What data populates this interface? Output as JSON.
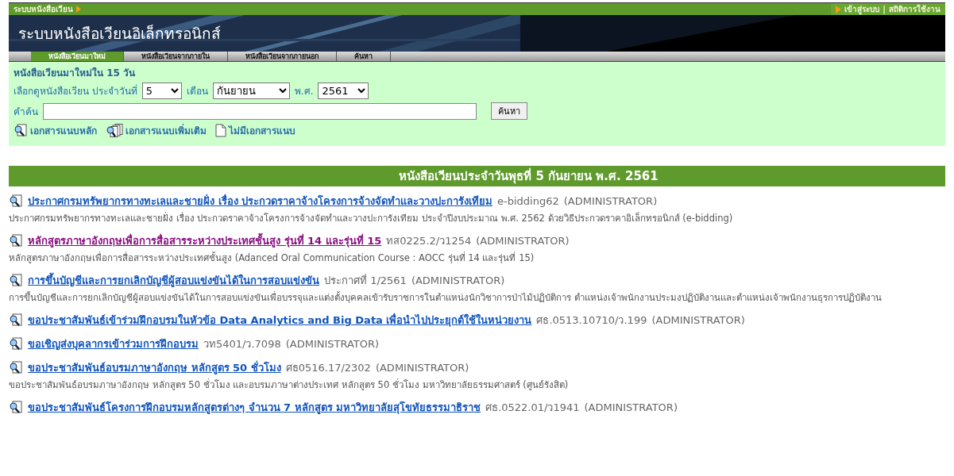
{
  "top_bar": {
    "title": "ระบบหนังสือเวียน",
    "links": [
      "เข้าสู่ระบบ",
      "สถิติการใช้งาน"
    ],
    "separator": "|"
  },
  "banner": {
    "title": "ระบบหนังสือเวียนอิเล็กทรอนิกส์"
  },
  "tabs": [
    {
      "label": "หนังสือเวียนมาใหม่",
      "selected": true
    },
    {
      "label": "หนังสือเวียนจากภายใน",
      "selected": false
    },
    {
      "label": "หนังสือเวียนจากภายนอก",
      "selected": false
    },
    {
      "label": "ค้นหา",
      "selected": false
    }
  ],
  "filter": {
    "heading": "หนังสือเวียนมาใหม่ใน 15 วัน",
    "date_label": "เลือกดูหนังสือเวียน ประจำวันที่",
    "day": "5",
    "month_label": "เดือน",
    "month": "กันยายน",
    "year_label": "พ.ศ.",
    "year": "2561",
    "keyword_label": "คำค้น",
    "search_button": "ค้นหา"
  },
  "legend": [
    {
      "kind": "main",
      "label": "เอกสารแนบหลัก"
    },
    {
      "kind": "extra",
      "label": "เอกสารแนบเพิ่มเติม"
    },
    {
      "kind": "none",
      "label": "ไม่มีเอกสารแนบ"
    }
  ],
  "list_heading": "หนังสือเวียนประจำวันพุธที่ 5 กันยายน พ.ศ. 2561",
  "items": [
    {
      "kind": "main",
      "title": "ประกาศกรมทรัพยากรทางทะเลและชายฝั่ง เรื่อง ประกวดราคาจ้างโครงการจ้างจัดทำและวางปะการังเทียม",
      "visited": false,
      "ref": "e-bidding62",
      "author": "(ADMINISTRATOR)",
      "description": "ประกาศกรมทรัพยากรทางทะเลและชายฝั่ง เรื่อง ประกวดราคาจ้างโครงการจ้างจัดทำและวางปะการังเทียม ประจำปีงบประมาณ พ.ศ. 2562 ด้วยวิธีประกวดราคาอิเล็กทรอนิกส์ (e-bidding)"
    },
    {
      "kind": "main",
      "title": "หลักสูตรภาษาอังกฤษเพื่อการสื่อสารระหว่างประเทศชั้นสูง รุ่นที่ 14 และรุ่นที่ 15",
      "visited": true,
      "ref": "ทส0225.2/ว1254",
      "author": "(ADMINISTRATOR)",
      "description": "หลักสูตรภาษาอังกฤษเพื่อการสื่อสารระหว่างประเทศชั้นสูง (Adanced Oral Communication Course : AOCC รุ่นที่ 14 และรุ่นที่ 15)"
    },
    {
      "kind": "main",
      "title": "การขึ้นบัญชีและการยกเลิกบัญชีผู้สอบแข่งขันได้ในการสอบแข่งขัน",
      "visited": false,
      "ref": "ประกาศที่ 1/2561",
      "author": "(ADMINISTRATOR)",
      "description": "การขึ้นบัญชีและการยกเลิกบัญชีผู้สอบแข่งขันได้ในการสอบแข่งขันเพื่อบรรจุและแต่งตั้งบุคคลเข้ารับราชการในตำแหน่งนักวิชาการป่าไม้ปฏิบัติการ ตำแหน่งเจ้าพนักงานประมงปฏิบัติงานและตำแหน่งเจ้าพนักงานธุรการปฏิบัติงาน"
    },
    {
      "kind": "main",
      "title": "ขอประชาสัมพันธ์เข้าร่วมฝึกอบรมในหัวข้อ Data Analytics and Big Data เพื่อนำไปประยุกต์ใช้ในหน่วยงาน",
      "visited": false,
      "ref": "ศธ.0513.10710/ว.199",
      "author": "(ADMINISTRATOR)"
    },
    {
      "kind": "main",
      "title": "ขอเชิญส่งบุคลากรเข้าร่วมการฝึกอบรม",
      "visited": false,
      "ref": "วท5401/ว.7098",
      "author": "(ADMINISTRATOR)"
    },
    {
      "kind": "main",
      "title": "ขอประชาสัมพันธ์อบรมภาษาอังกฤษ หลักสูตร 50 ชั่วโมง",
      "visited": false,
      "ref": "ศธ0516.17/2302",
      "author": "(ADMINISTRATOR)",
      "description": "ขอประชาสัมพันธ์อบรมภาษาอังกฤษ หลักสูตร 50 ชั่วโมง และอบรมภาษาต่างประเทศ หลักสูตร 50 ชั่วโมง มหาวิทยาลัยธรรมศาสตร์ (ศูนย์รังสิต)"
    },
    {
      "kind": "main",
      "title": "ขอประชาสัมพันธ์โครงการฝึกอบรมหลักสูตรต่างๆ จำนวน 7 หลักสูตร มหาวิทยาลัยสุโขทัยธรรมาธิราช",
      "visited": false,
      "ref": "ศธ.0522.01/ว1941",
      "author": "(ADMINISTRATOR)"
    }
  ]
}
